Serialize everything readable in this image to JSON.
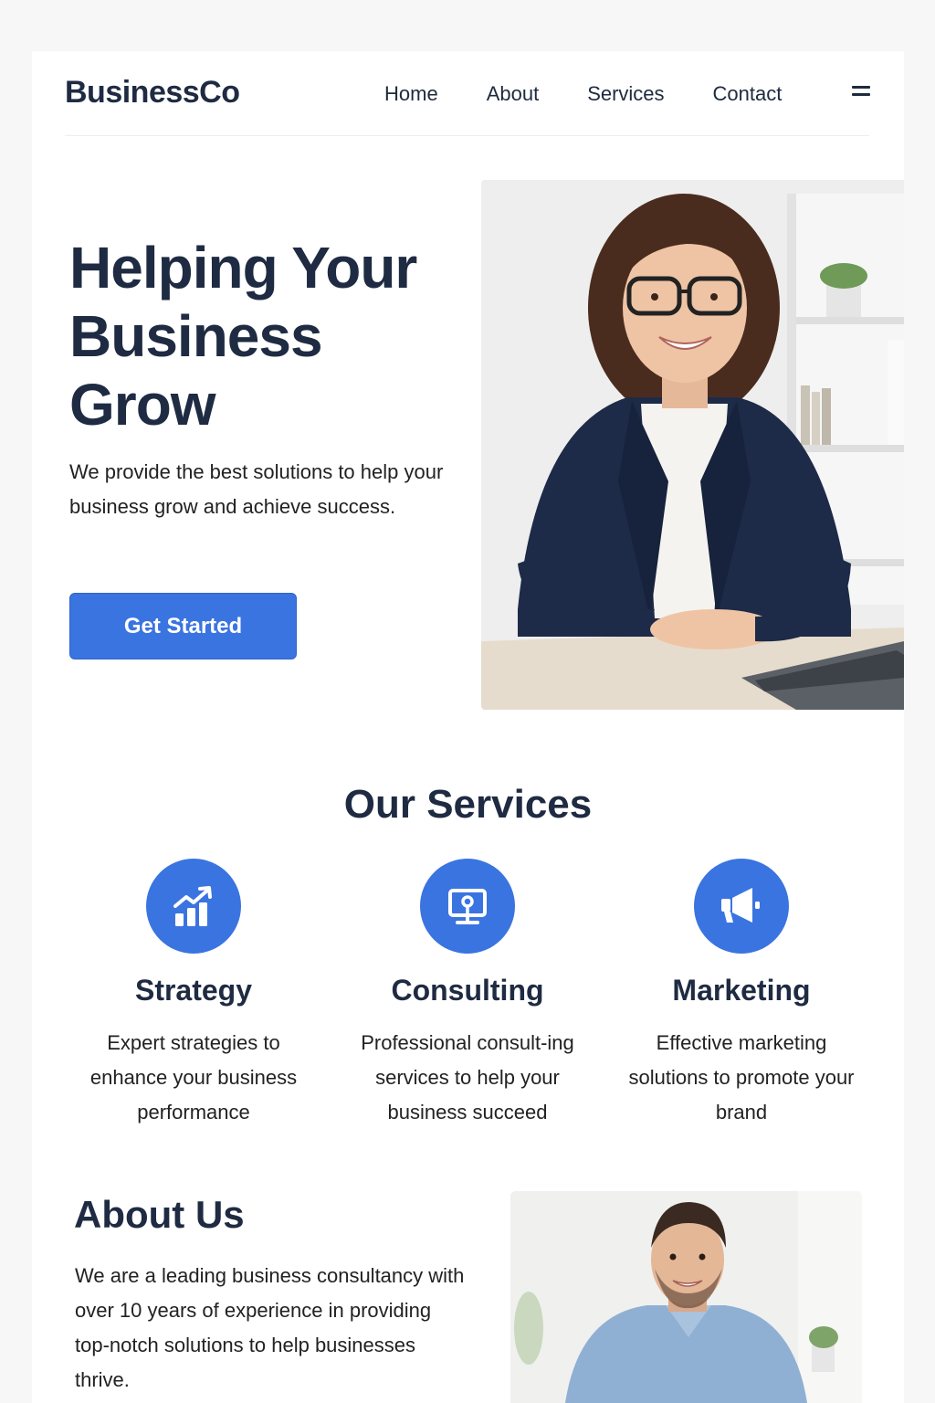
{
  "header": {
    "brand": "BusinessCo",
    "nav": [
      "Home",
      "About",
      "Services",
      "Contact"
    ]
  },
  "hero": {
    "title": "Helping Your Business Grow",
    "text": "We provide the best solutions to help your business grow and achieve success.",
    "cta": "Get Started"
  },
  "services": {
    "title": "Our Services",
    "items": [
      {
        "name": "Strategy",
        "desc": "Expert strategies to enhance your business performance",
        "icon": "chart-growth-icon"
      },
      {
        "name": "Consulting",
        "desc": "Professional consult-ing services to help your business succeed",
        "icon": "monitor-icon"
      },
      {
        "name": "Marketing",
        "desc": "Effective marketing solutions to promote your brand",
        "icon": "megaphone-icon"
      }
    ]
  },
  "about": {
    "title": "About Us",
    "text": "We are a leading business consultancy with over 10 years of experience in providing top-notch solutions to help businesses thrive."
  },
  "colors": {
    "accent": "#3a74e0",
    "heading": "#1f2b42"
  }
}
